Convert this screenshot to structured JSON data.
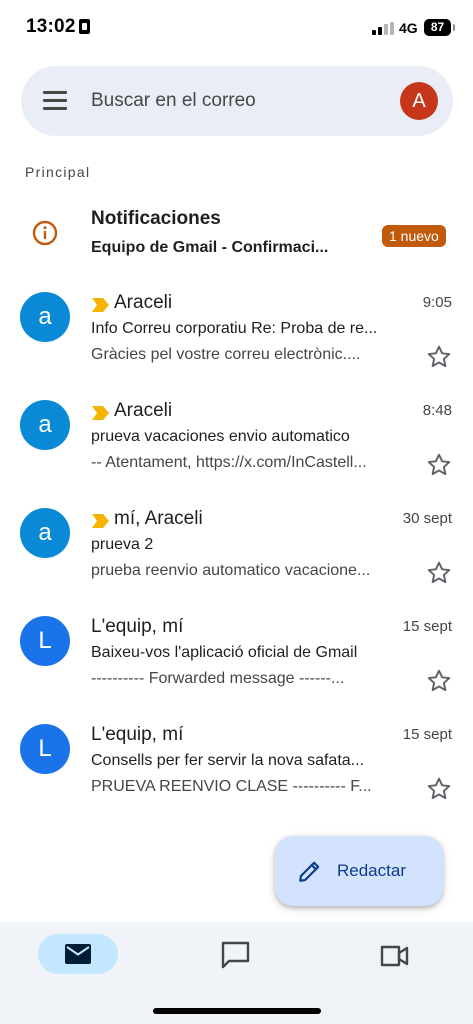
{
  "status_bar": {
    "time": "13:02",
    "network": "4G",
    "battery": "87"
  },
  "search": {
    "placeholder": "Buscar en el correo",
    "account_initial": "A"
  },
  "section": {
    "label": "Principal"
  },
  "notification": {
    "title": "Notificaciones",
    "subtitle": "Equipo de Gmail - Confirmaci...",
    "badge": "1 nuevo"
  },
  "emails": [
    {
      "initial": "a",
      "avatar_color": "#0a8ad6",
      "important": true,
      "sender": "Araceli",
      "date": "9:05",
      "subject": "Info Correu corporatiu Re: Proba de re...",
      "snippet": "Gràcies pel vostre correu electrònic...."
    },
    {
      "initial": "a",
      "avatar_color": "#0a8ad6",
      "important": true,
      "sender": "Araceli",
      "date": "8:48",
      "subject": "prueva vacaciones envio automatico",
      "snippet": "-- Atentament, https://x.com/InCastell..."
    },
    {
      "initial": "a",
      "avatar_color": "#0a8ad6",
      "important": true,
      "sender": "mí, Araceli",
      "date": "30 sept",
      "subject": "prueva 2",
      "snippet": "prueba reenvio automatico vacacione..."
    },
    {
      "initial": "L",
      "avatar_color": "#1a73e8",
      "important": false,
      "sender": "L'equip, mí",
      "date": "15 sept",
      "subject": "Baixeu-vos l'aplicació oficial de Gmail",
      "snippet": "---------- Forwarded message ------..."
    },
    {
      "initial": "L",
      "avatar_color": "#1a73e8",
      "important": false,
      "sender": "L'equip, mí",
      "date": "15 sept",
      "subject": "Consells per fer servir la nova safata...",
      "snippet": "PRUEVA REENVIO CLASE ---------- F..."
    }
  ],
  "compose": {
    "label": "Redactar"
  },
  "bottom_nav": {
    "items": [
      "mail-icon",
      "chat-icon",
      "video-icon"
    ]
  },
  "colors": {
    "search_bg": "#e9eef6",
    "account_avatar": "#c5361a",
    "badge": "#c25a0c",
    "importance_marker": "#f4b400",
    "compose_bg": "#d3e3fd",
    "nav_active": "#c2e7ff"
  }
}
